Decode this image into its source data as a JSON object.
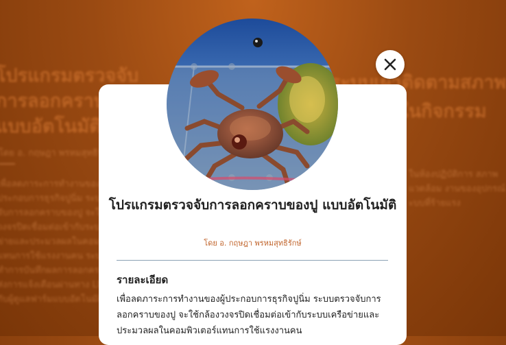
{
  "background_page": {
    "title_left": "โปรแกรมตรวจจับการลอกคราบแบบอัตโนมัติ",
    "author_left": "โดย อ. กฤษฎา พรหมสุทธิรักษ์",
    "body_left": "เพื่อลดภาระการทำงานของผู้ประกอบการธุรกิจปูนิ่ม ระบบตรวจจับการลอกคราบของปู จะใช้กล้องวงจรปิดเชื่อมต่อเข้ากับระบบเครือข่ายและประมวลผลในคอมพิวเตอร์แทนการใช้แรงงานคน ระบบจะทำการบันทึกผลการลอกคราบและส่งการแจ้งเตือนผ่านทาง LINE ให้กับผู้ดูแลฟาร์มแบบอัตโนมัติ",
    "title_right": "ระบบเฝ้าติดตามสภาพแวดล้อมในกิจกรรม",
    "body_right": "ในห้องปฏิบัติการ สภาพแวดล้อม งานของอุปกรณ์ ะบบที่ร้ายแรง"
  },
  "modal": {
    "title": "โปรแกรมตรวจจับการลอกคราบของปู แบบอัตโนมัติ",
    "author": "โดย อ. กฤษฎา พรหมสุทธิรักษ์",
    "section_heading": "รายละเอียด",
    "description": "เพื่อลดภาระการทำงานของผู้ประกอบการธุรกิจปูนิ่ม ระบบตรวจจับการลอกคราบของปู จะใช้กล้องวงจรปิดเชื่อมต่อเข้ากับระบบเครือข่ายและประมวลผลในคอมพิวเตอร์แทนการใช้แรงงานคน",
    "close_icon": "close-icon",
    "photo_icon": "crab-photo",
    "accent_color": "#c0632a"
  }
}
